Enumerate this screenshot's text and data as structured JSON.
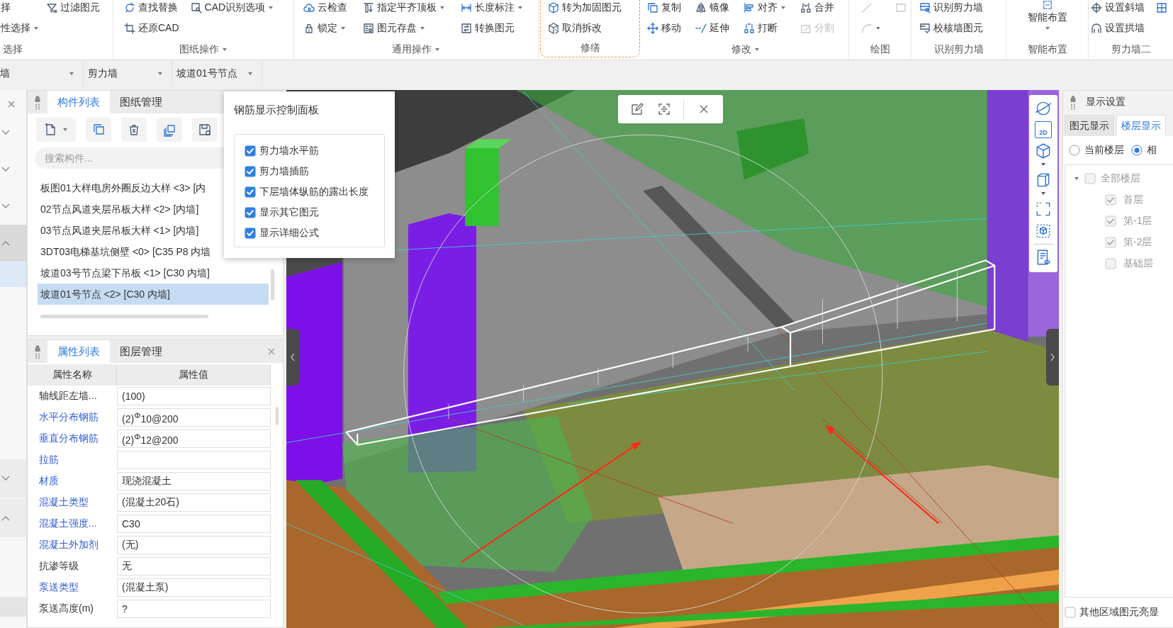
{
  "ribbon": {
    "groups": [
      {
        "label": "选择",
        "menu": false,
        "highlighted": false,
        "kind": "rows",
        "rows": [
          [
            {
              "label": "择",
              "dropdown": false,
              "disabled": false
            },
            {
              "label": "过滤图元",
              "dropdown": false,
              "disabled": false
            }
          ],
          [
            {
              "label": "性选择",
              "dropdown": true,
              "disabled": false
            }
          ]
        ]
      },
      {
        "label": "图纸操作",
        "menu": true,
        "highlighted": false,
        "kind": "rows",
        "rows": [
          [
            {
              "label": "查找替换",
              "dropdown": false,
              "disabled": false
            },
            {
              "label": "CAD识别选项",
              "dropdown": true,
              "disabled": false
            }
          ],
          [
            {
              "label": "还原CAD",
              "dropdown": false,
              "disabled": false
            }
          ]
        ]
      },
      {
        "label": "通用操作",
        "menu": true,
        "highlighted": false,
        "kind": "rows",
        "rows": [
          [
            {
              "label": "云检查",
              "dropdown": false,
              "disabled": false
            },
            {
              "label": "指定平齐顶板",
              "dropdown": true,
              "disabled": false
            },
            {
              "label": "长度标注",
              "dropdown": true,
              "disabled": false
            }
          ],
          [
            {
              "label": "锁定",
              "dropdown": true,
              "disabled": false
            },
            {
              "label": "图元存盘",
              "dropdown": true,
              "disabled": false
            },
            {
              "label": "转换图元",
              "dropdown": false,
              "disabled": false
            }
          ]
        ]
      },
      {
        "label": "修缮",
        "menu": false,
        "highlighted": true,
        "kind": "rows",
        "rows": [
          [
            {
              "label": "转为加固图元",
              "dropdown": false,
              "disabled": false
            }
          ],
          [
            {
              "label": "取消拆改",
              "dropdown": false,
              "disabled": false
            }
          ]
        ]
      },
      {
        "label": "修改",
        "menu": true,
        "highlighted": false,
        "kind": "rows",
        "rows": [
          [
            {
              "label": "复制",
              "dropdown": false,
              "disabled": false
            },
            {
              "label": "镜像",
              "dropdown": false,
              "disabled": false
            },
            {
              "label": "对齐",
              "dropdown": true,
              "disabled": false
            },
            {
              "label": "合并",
              "dropdown": false,
              "disabled": false
            }
          ],
          [
            {
              "label": "移动",
              "dropdown": false,
              "disabled": false
            },
            {
              "label": "延伸",
              "dropdown": false,
              "disabled": false
            },
            {
              "label": "打断",
              "dropdown": false,
              "disabled": false
            },
            {
              "label": "分割",
              "dropdown": false,
              "disabled": true
            }
          ]
        ]
      },
      {
        "label": "绘图",
        "menu": false,
        "highlighted": false,
        "kind": "rows",
        "rows": [
          [
            {
              "dropdown": false,
              "disabled": true
            },
            {
              "dropdown": false,
              "disabled": true
            }
          ],
          [
            {
              "dropdown": true,
              "disabled": true
            }
          ]
        ]
      },
      {
        "label": "识别剪力墙",
        "menu": false,
        "highlighted": false,
        "kind": "rows",
        "rows": [
          [
            {
              "label": "识别剪力墙",
              "dropdown": false,
              "disabled": false
            }
          ],
          [
            {
              "label": "校核墙图元",
              "dropdown": false,
              "disabled": false
            }
          ]
        ]
      },
      {
        "label": "智能布置",
        "menu": false,
        "highlighted": false,
        "kind": "large",
        "rows": [
          [
            {
              "label": "智能布置",
              "dropdown": true,
              "disabled": false
            }
          ]
        ]
      },
      {
        "label": "剪力墙二",
        "menu": false,
        "highlighted": false,
        "kind": "rows",
        "rows": [
          [
            {
              "label": "设置斜墙",
              "dropdown": false,
              "disabled": false
            },
            {
              "dropdown": false,
              "disabled": false
            }
          ],
          [
            {
              "label": "设置拱墙",
              "dropdown": false,
              "disabled": false
            }
          ]
        ]
      }
    ]
  },
  "filter_bar": {
    "dropdowns": [
      {
        "value": "墙"
      },
      {
        "value": "剪力墙"
      },
      {
        "value": "坡道01号节点"
      }
    ]
  },
  "side_strip": {
    "top": [
      {
        "expanded": false
      },
      {
        "expanded": false
      },
      {
        "expanded": false
      },
      {
        "expanded": true
      }
    ],
    "bottom": [
      {
        "expanded": false
      },
      {
        "expanded": true
      }
    ]
  },
  "component_panel": {
    "tabs": [
      {
        "label": "构件列表",
        "selected": true
      },
      {
        "label": "图纸管理",
        "selected": false
      }
    ],
    "search": {
      "placeholder": "搜索构件..."
    },
    "items": [
      {
        "label": "板图01大样电房外圈反边大样 <3> [内",
        "selected": false
      },
      {
        "label": "02节点风道夹层吊板大样 <2> [内墙]",
        "selected": false
      },
      {
        "label": "03节点风道夹层吊板大样 <1> [内墙]",
        "selected": false
      },
      {
        "label": "3DT03电梯基坑侧壁 <0> [C35 P8 内墙",
        "selected": false
      },
      {
        "label": "坡道03号节点梁下吊板 <1> [C30 内墙]",
        "selected": false
      },
      {
        "label": "坡道01号节点 <2> [C30 内墙]",
        "selected": true
      }
    ]
  },
  "rebar_panel": {
    "title": "钢筋显示控制面板",
    "options": [
      {
        "label": "剪力墙水平筋",
        "checked": true
      },
      {
        "label": "剪力墙插筋",
        "checked": true
      },
      {
        "label": "下层墙体纵筋的露出长度",
        "checked": true
      },
      {
        "label": "显示其它图元",
        "checked": true
      },
      {
        "label": "显示详细公式",
        "checked": true
      }
    ]
  },
  "property_panel": {
    "tabs": [
      {
        "label": "属性列表",
        "selected": true
      },
      {
        "label": "图层管理",
        "selected": false
      }
    ],
    "columns": [
      "属性名称",
      "属性值"
    ],
    "rows": [
      {
        "name": "轴线距左墙...",
        "public": false,
        "value": "(100)"
      },
      {
        "name": "水平分布钢筋",
        "public": true,
        "value": "(2)$^{Φ}$10@200"
      },
      {
        "name": "垂直分布钢筋",
        "public": true,
        "value": "(2)$^{Φ}$12@200"
      },
      {
        "name": "拉筋",
        "public": true
      },
      {
        "name": "材质",
        "public": true,
        "value": "现浇混凝土"
      },
      {
        "name": "混凝土类型",
        "public": true,
        "value": "(混凝土20石)"
      },
      {
        "name": "混凝土强度...",
        "public": true,
        "value": "C30"
      },
      {
        "name": "混凝土外加剂",
        "public": true,
        "value": "(无)"
      },
      {
        "name": "抗渗等级",
        "public": false,
        "value": "无"
      },
      {
        "name": "泵送类型",
        "public": true,
        "value": "(混凝土泵)"
      },
      {
        "name": "泵送高度(m)",
        "public": false,
        "value": "?"
      }
    ]
  },
  "viewport": {
    "view_toolbar": [
      {
        "dropdown": false
      },
      {
        "label": "2D",
        "dropdown": false
      },
      {
        "dropdown": true
      },
      {
        "dropdown": true
      },
      {
        "dropdown": false
      },
      {
        "dropdown": false
      },
      {
        "dropdown": false
      }
    ]
  },
  "display_panel": {
    "title": "显示设置",
    "tabs": [
      {
        "label": "图元显示",
        "selected": false
      },
      {
        "label": "楼层显示",
        "selected": true
      }
    ],
    "scope": [
      {
        "label": "当前楼层",
        "selected": false
      },
      {
        "label": "相",
        "selected": true
      }
    ],
    "floors": [
      {
        "label": "全部楼层",
        "checked": false,
        "expanded": true,
        "disabled": true,
        "children": [
          {
            "label": "首层",
            "checked": true,
            "disabled": true
          },
          {
            "label": "第-1层",
            "checked": true,
            "disabled": true
          },
          {
            "label": "第-2层",
            "checked": true,
            "disabled": true
          },
          {
            "label": "基础层",
            "checked": false,
            "disabled": true
          }
        ]
      }
    ],
    "highlight_other": {
      "label": "其他区域图元亮显",
      "checked": false
    }
  }
}
